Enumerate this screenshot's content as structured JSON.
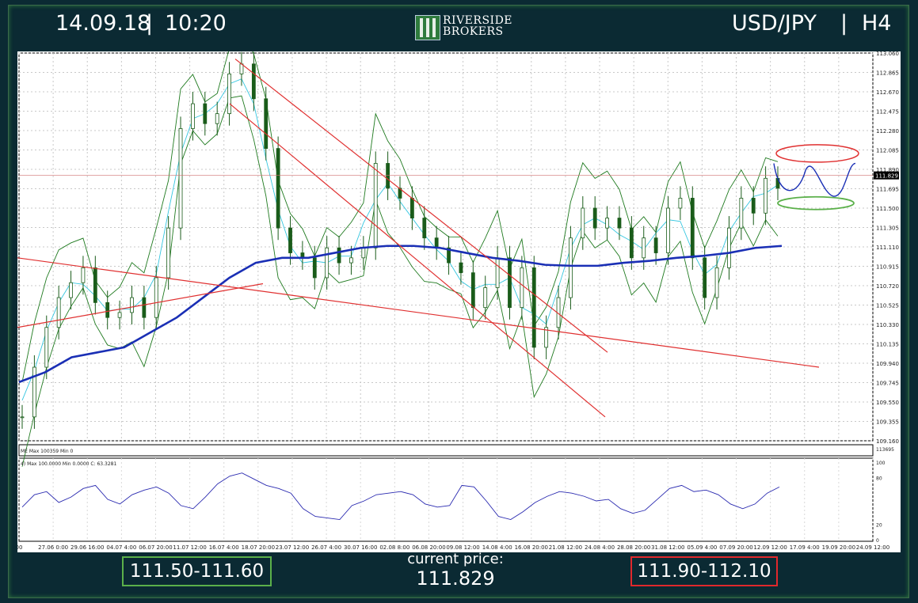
{
  "header": {
    "date": "14.09.18",
    "time": "10:20",
    "brand_line1": "RIVERSIDE",
    "brand_line2": "BROKERS",
    "pair": "USD/JPY",
    "timeframe": "H4",
    "separator": "|"
  },
  "footer": {
    "support_range": "111.50-111.60",
    "current_price_label": "current price:",
    "current_price": "111.829",
    "resistance_range": "111.90-112.10"
  },
  "colors": {
    "background": "#0b2a33",
    "support_box": "#5bb04a",
    "resistance_box": "#e0282c",
    "trendline": "#e03030",
    "ma_slow": "#1a2fb5",
    "bollinger": "#1f7a1f",
    "ma_fast": "#35c6e0"
  },
  "chart_data": {
    "type": "line",
    "title": "",
    "ylim": [
      109.16,
      113.06
    ],
    "yticks": [
      "113.060",
      "112.865",
      "112.670",
      "112.475",
      "112.280",
      "112.085",
      "111.890",
      "111.695",
      "111.500",
      "111.305",
      "111.110",
      "110.915",
      "110.720",
      "110.525",
      "110.330",
      "110.135",
      "109.940",
      "109.745",
      "109.550",
      "109.355",
      "109.160"
    ],
    "current_price_tag": "111.829",
    "x_labels": [
      "00",
      "27.06 0:00",
      "29.06 16:00",
      "04.07 4:00",
      "06.07 20:00",
      "11.07 12:00",
      "16.07 4:00",
      "18.07 20:00",
      "23.07 12:00",
      "26.07 4:00",
      "30.07 16:00",
      "02.08 8:00",
      "06.08 20:00",
      "09.08 12:00",
      "14.08 4:00",
      "16.08 20:00",
      "21.08 12:00",
      "24.08 4:00",
      "28.08 20:00",
      "31.08 12:00",
      "05.09 4:00",
      "07.09 20:00",
      "12.09 12:00",
      "17.09 4:00",
      "19.09 20:00",
      "24.09 12:00"
    ],
    "series": [
      {
        "values": [
          109.4,
          109.9,
          110.3,
          110.6,
          110.75,
          110.9,
          110.55,
          110.4,
          110.45,
          110.6,
          110.4,
          110.8,
          111.3,
          112.3,
          112.55,
          112.35,
          112.45,
          112.85,
          112.95,
          112.6,
          112.1,
          111.3,
          111.05,
          111.0,
          110.8,
          111.1,
          110.95,
          111.0,
          111.1,
          111.95,
          111.7,
          111.6,
          111.4,
          111.2,
          111.1,
          110.95,
          110.85,
          110.5,
          110.7,
          111.0,
          110.5,
          110.9,
          110.1,
          110.3,
          110.6,
          111.2,
          111.5,
          111.3,
          111.4,
          111.3,
          111.0,
          111.2,
          111.05,
          111.5,
          111.6,
          111.0,
          110.6,
          110.9,
          111.3,
          111.6,
          111.45,
          111.8,
          111.7
        ]
      },
      {
        "name": "",
        "values": [
          109.75,
          109.85,
          110.0,
          110.05,
          110.1,
          110.25,
          110.4,
          110.6,
          110.8,
          110.95,
          111.0,
          111.0,
          111.05,
          111.1,
          111.12,
          111.12,
          111.1,
          111.05,
          111.0,
          110.97,
          110.93,
          110.92,
          110.92,
          110.95,
          110.97,
          111.0,
          111.02,
          111.05,
          111.1,
          111.12
        ]
      }
    ],
    "indicator": {
      "label_volume": "ME  Max 100359  Min 0",
      "volume_right": "113695",
      "label_osc": "4)  Max 100.0000  Min 0.0000  C: 63.3281",
      "osc_ticks": [
        "100",
        "80",
        "20",
        "0"
      ],
      "values": [
        42,
        58,
        62,
        48,
        55,
        66,
        70,
        52,
        46,
        58,
        64,
        68,
        60,
        44,
        40,
        55,
        72,
        82,
        86,
        78,
        70,
        66,
        60,
        40,
        30,
        28,
        26,
        44,
        50,
        58,
        60,
        62,
        58,
        46,
        42,
        44,
        70,
        68,
        50,
        30,
        26,
        36,
        48,
        56,
        62,
        60,
        56,
        50,
        52,
        40,
        34,
        38,
        52,
        66,
        70,
        62,
        64,
        58,
        46,
        40,
        46,
        60,
        68
      ]
    }
  }
}
